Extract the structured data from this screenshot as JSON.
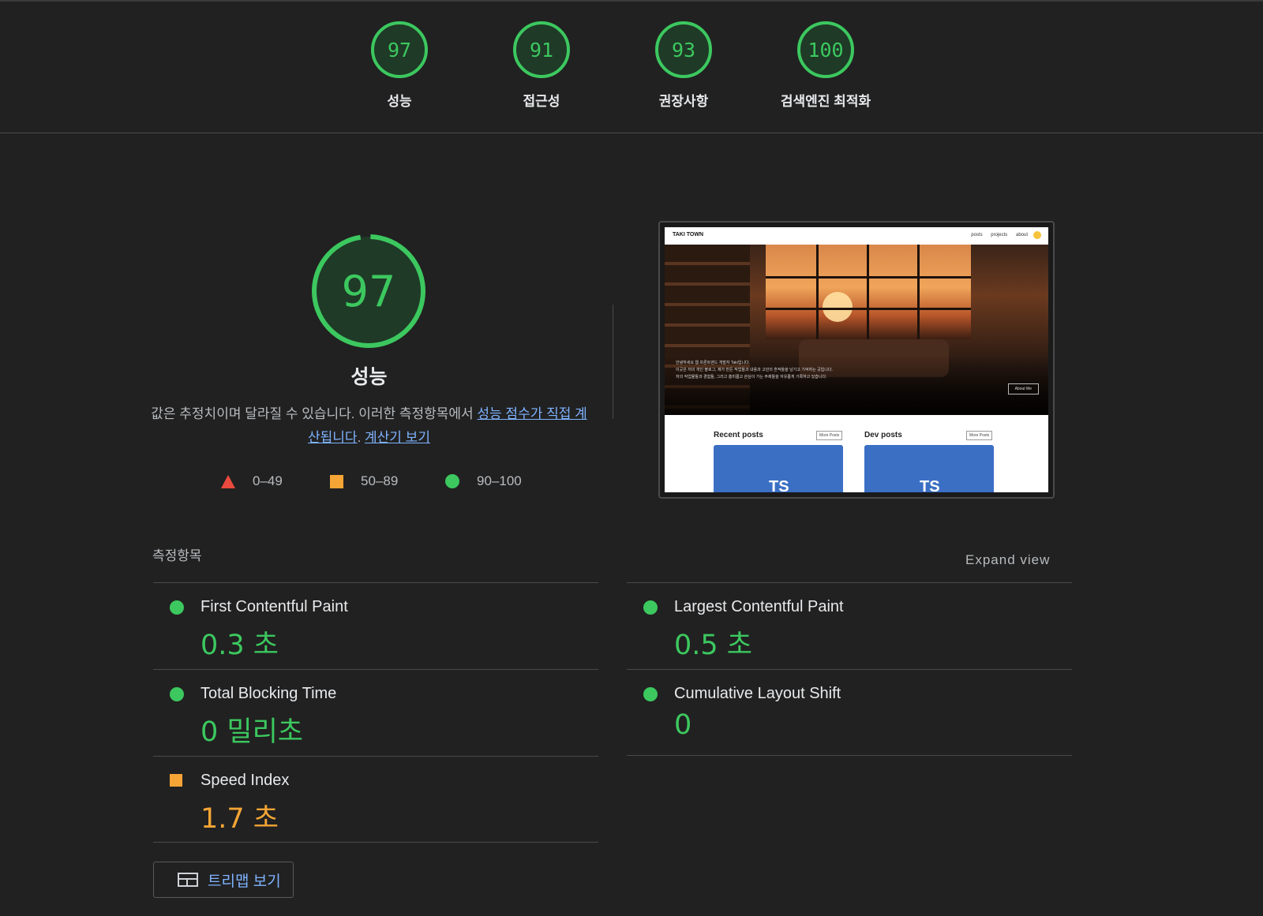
{
  "colors": {
    "pass": "#3cc85f",
    "average": "#f4a535",
    "fail": "#eb4a3e",
    "link": "#7fb3ff",
    "background": "#212121"
  },
  "gauges": [
    {
      "score": 97,
      "label": "성능"
    },
    {
      "score": 91,
      "label": "접근성"
    },
    {
      "score": 93,
      "label": "권장사항"
    },
    {
      "score": 100,
      "label": "검색엔진 최적화"
    }
  ],
  "performance": {
    "score": 97,
    "title": "성능",
    "description": "값은 추정치이며 달라질 수 있습니다. 이러한 측정항목에서 ",
    "link1": "성능 점수가 직접 계산됩니다",
    "link2": "계산기 보기",
    "separator": ". "
  },
  "legend": [
    {
      "shape": "triangle",
      "range": "0–49"
    },
    {
      "shape": "square",
      "range": "50–89"
    },
    {
      "shape": "circle",
      "range": "90–100"
    }
  ],
  "screenshot": {
    "brand": "TAKI TOWN",
    "nav": [
      "posts",
      "projects",
      "about"
    ],
    "hero_lines": [
      "안녕하세요 웹 프론트엔드 개발자 Taki입니다.",
      "이곳은 저의 개인 블로그, 제가 만든 작업들과 내용과 고민의 흔적들을 남기고 기억하는 곳입니다.",
      "저의 작업물들과 경험들, 그리고 흥미롭고 관심이 가는 주제들을 자유롭게 기록하고 있습니다."
    ],
    "hero_button": "About Me",
    "sections": [
      {
        "title": "Recent posts",
        "more": "More Posts",
        "card": "TS"
      },
      {
        "title": "Dev posts",
        "more": "More Posts",
        "card": "TS"
      }
    ]
  },
  "metrics_header": "측정항목",
  "expand_view": "Expand view",
  "metrics_left": [
    {
      "name": "First Contentful Paint",
      "value": "0.3 초",
      "status": "pass"
    },
    {
      "name": "Total Blocking Time",
      "value": "0 밀리초",
      "status": "pass"
    },
    {
      "name": "Speed Index",
      "value": "1.7 초",
      "status": "average"
    }
  ],
  "metrics_right": [
    {
      "name": "Largest Contentful Paint",
      "value": "0.5 초",
      "status": "pass"
    },
    {
      "name": "Cumulative Layout Shift",
      "value": "0",
      "status": "pass"
    }
  ],
  "treemap_button": "트리맵 보기"
}
